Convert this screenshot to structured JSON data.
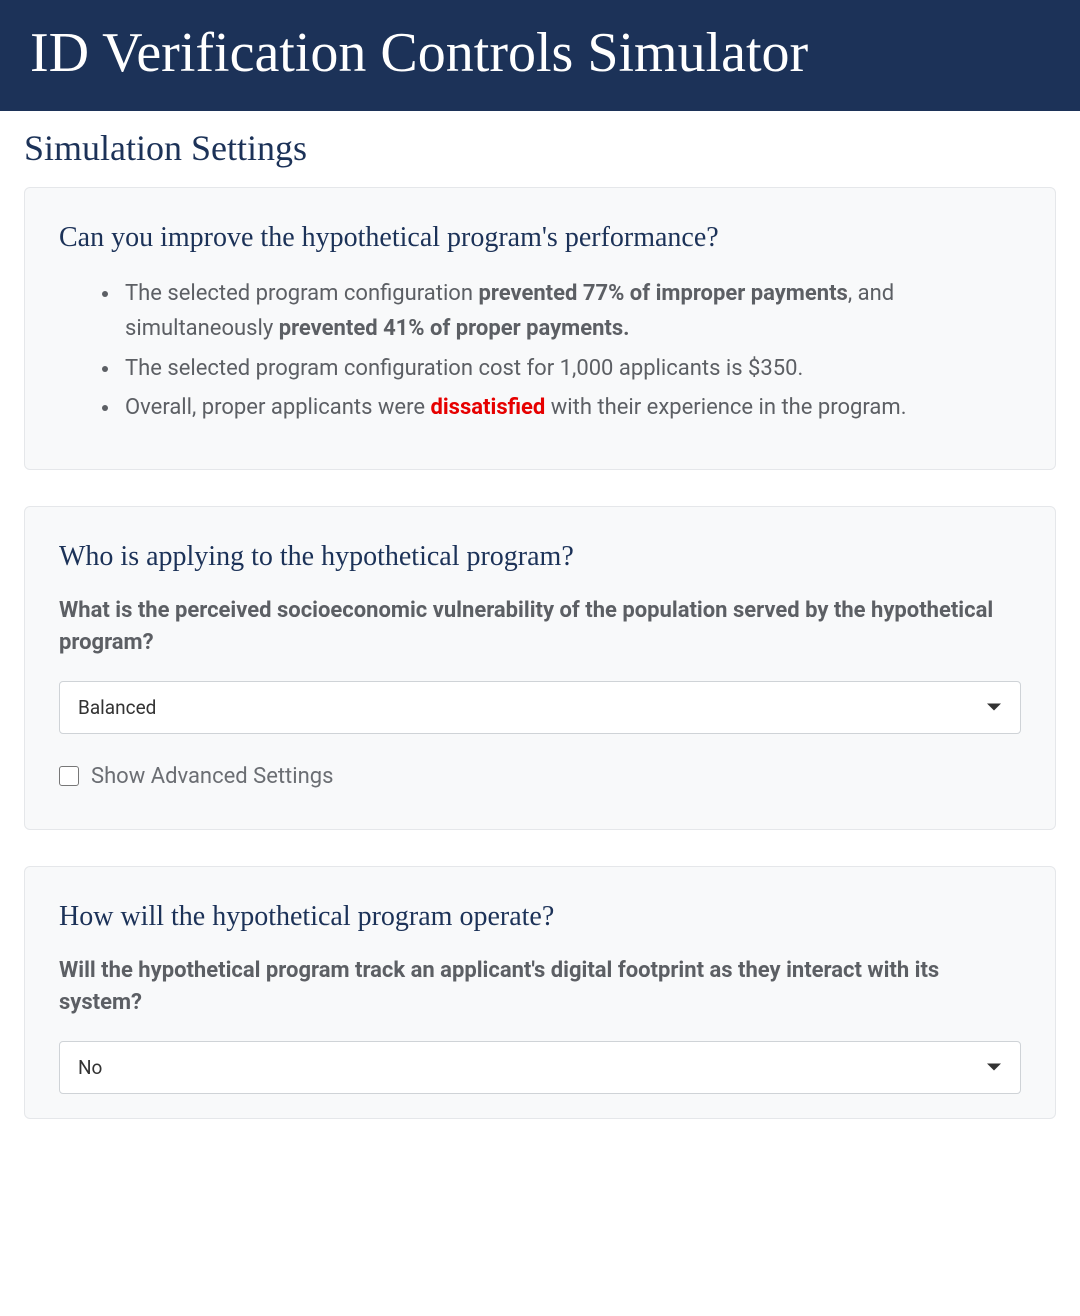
{
  "header": {
    "title": "ID Verification Controls Simulator"
  },
  "settings": {
    "title": "Simulation Settings"
  },
  "results": {
    "heading": "Can you improve the hypothetical program's performance?",
    "bullet1_prefix": "The selected program configuration ",
    "bullet1_strong1": "prevented 77% of improper payments",
    "bullet1_mid": ", and simultaneously ",
    "bullet1_strong2": "prevented 41% of proper payments.",
    "bullet2": "The selected program configuration cost for 1,000 applicants is $350.",
    "bullet3_prefix": "Overall, proper applicants were ",
    "bullet3_highlight": "dissatisfied",
    "bullet3_suffix": " with their experience in the program."
  },
  "who": {
    "heading": "Who is applying to the hypothetical program?",
    "question_label": "What is the perceived socioeconomic vulnerability of the population served by the hypothetical program?",
    "select_value": "Balanced",
    "advanced_label": "Show Advanced Settings"
  },
  "how": {
    "heading": "How will the hypothetical program operate?",
    "question_label": "Will the hypothetical program track an applicant's digital footprint as they interact with its system?",
    "select_value": "No"
  }
}
